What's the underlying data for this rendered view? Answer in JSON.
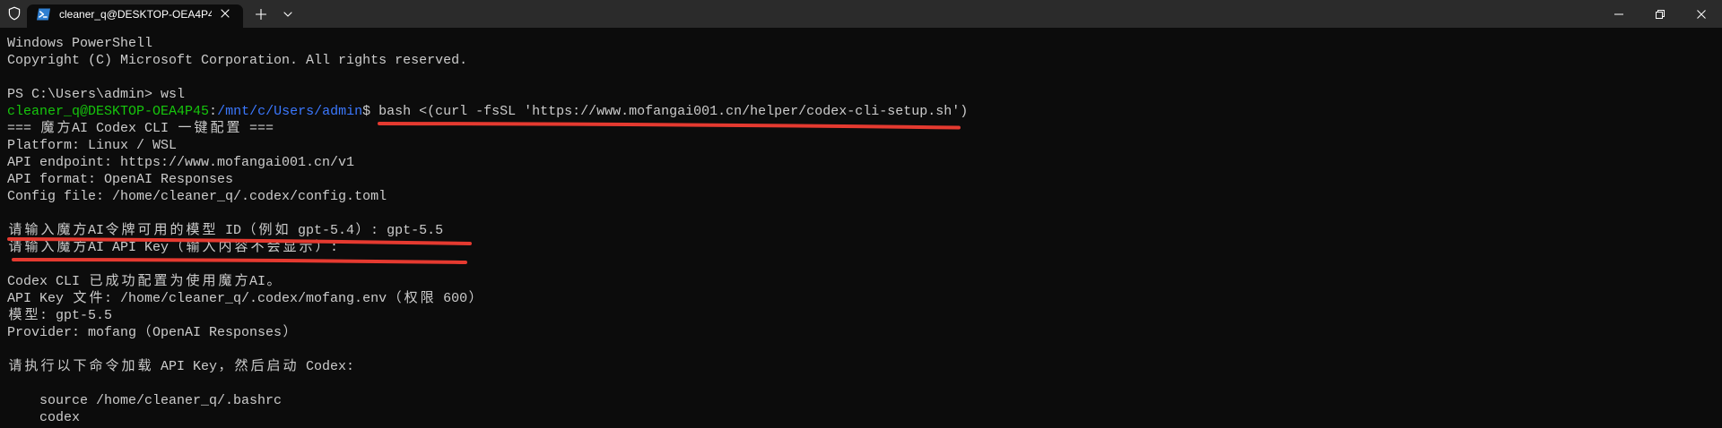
{
  "window": {
    "tab": {
      "title": "cleaner_q@DESKTOP-OEA4P4",
      "icon": "powershell-icon"
    },
    "icons": {
      "elevation": "shield-icon",
      "tab_close": "close-icon",
      "new_tab": "plus-icon",
      "tab_dropdown": "chevron-down-icon",
      "minimize": "minimize-icon",
      "restore": "restore-icon",
      "close": "window-close-icon"
    }
  },
  "terminal": {
    "banner": {
      "title": "Windows PowerShell",
      "copyright": "Copyright (C) Microsoft Corporation. All rights reserved."
    },
    "powershell": {
      "prompt": "PS C:\\Users\\admin>",
      "command": "wsl"
    },
    "bash": {
      "user_host": "cleaner_q@DESKTOP-OEA4P45",
      "separator": ":",
      "path": "/mnt/c/Users/admin",
      "symbol": "$",
      "command": "bash <(curl -fsSL 'https://www.mofangai001.cn/helper/codex-cli-setup.sh')"
    },
    "setup": {
      "header": "=== 魔方AI Codex CLI 一键配置 ===",
      "info": [
        "Platform: Linux / WSL",
        "API endpoint: https://www.mofangai001.cn/v1",
        "API format: OpenAI Responses",
        "Config file: /home/cleaner_q/.codex/config.toml"
      ],
      "prompts": [
        {
          "question": "请输入魔方AI令牌可用的模型 ID（例如 gpt-5.4）:",
          "answer": "gpt-5.5"
        },
        {
          "question": "请输入魔方AI API Key（输入内容不会显示）:"
        }
      ],
      "result": [
        "Codex CLI 已成功配置为使用魔方AI。",
        "API Key 文件: /home/cleaner_q/.codex/mofang.env（权限 600）",
        "模型: gpt-5.5",
        "Provider: mofang（OpenAI Responses）"
      ],
      "instruction": "请执行以下命令加载 API Key，然后启动 Codex:",
      "commands": [
        "source /home/cleaner_q/.bashrc",
        "codex"
      ]
    }
  },
  "colors": {
    "terminal_background": "#0c0c0c",
    "terminal_foreground": "#cccccc",
    "prompt_user_host": "#16c60c",
    "prompt_path": "#3b78ff",
    "annotation_red": "#e53a30",
    "tab_row": "#2b2b2b",
    "tab_selected": "#0c0c0c"
  }
}
